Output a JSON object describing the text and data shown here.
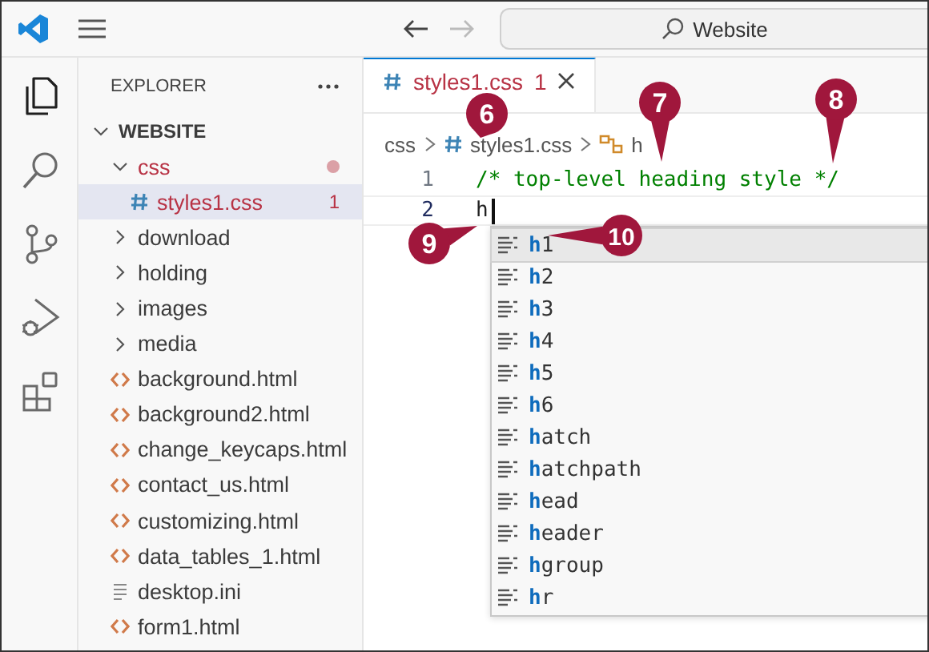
{
  "title_bar": {
    "back_enabled": true,
    "forward_enabled": false,
    "search": "Website"
  },
  "activity_bar": [
    {
      "kind": "explorer",
      "selected": true
    },
    {
      "kind": "search",
      "selected": false
    },
    {
      "kind": "source-control",
      "selected": false
    },
    {
      "kind": "run-debug",
      "selected": false
    },
    {
      "kind": "extensions",
      "selected": false
    }
  ],
  "explorer": {
    "title": "EXPLORER",
    "root": {
      "label": "WEBSITE",
      "expanded": true,
      "children": [
        {
          "label": "css",
          "kind": "folder",
          "expanded": true,
          "has_errors": true,
          "children": [
            {
              "label": "styles1.css",
              "kind": "css",
              "selected": true,
              "has_errors": true,
              "problems": "1"
            }
          ]
        },
        {
          "label": "download",
          "kind": "folder",
          "expanded": false
        },
        {
          "label": "holding",
          "kind": "folder",
          "expanded": false
        },
        {
          "label": "images",
          "kind": "folder",
          "expanded": false
        },
        {
          "label": "media",
          "kind": "folder",
          "expanded": false
        },
        {
          "label": "background.html",
          "kind": "html"
        },
        {
          "label": "background2.html",
          "kind": "html"
        },
        {
          "label": "change_keycaps.html",
          "kind": "html"
        },
        {
          "label": "contact_us.html",
          "kind": "html"
        },
        {
          "label": "customizing.html",
          "kind": "html"
        },
        {
          "label": "data_tables_1.html",
          "kind": "html"
        },
        {
          "label": "desktop.ini",
          "kind": "text"
        },
        {
          "label": "form1.html",
          "kind": "html"
        }
      ]
    }
  },
  "editor": {
    "tabs": [
      {
        "label": "styles1.css",
        "problems": "1",
        "selected": true
      }
    ],
    "breadcrumb": [
      {
        "kind": "folder",
        "label": "css"
      },
      {
        "kind": "css",
        "label": "styles1.css"
      },
      {
        "kind": "symbol",
        "label": "h"
      }
    ],
    "lines": [
      {
        "number": "1",
        "text": "/* top-level heading style */",
        "kind": "comment",
        "current": false
      },
      {
        "number": "2",
        "text": "h",
        "kind": "code",
        "current": true
      }
    ],
    "suggestions": [
      {
        "match": "h",
        "rest": "1",
        "selected": true
      },
      {
        "match": "h",
        "rest": "2",
        "selected": false
      },
      {
        "match": "h",
        "rest": "3",
        "selected": false
      },
      {
        "match": "h",
        "rest": "4",
        "selected": false
      },
      {
        "match": "h",
        "rest": "5",
        "selected": false
      },
      {
        "match": "h",
        "rest": "6",
        "selected": false
      },
      {
        "match": "h",
        "rest": "atch",
        "selected": false
      },
      {
        "match": "h",
        "rest": "atchpath",
        "selected": false
      },
      {
        "match": "h",
        "rest": "ead",
        "selected": false
      },
      {
        "match": "h",
        "rest": "eader",
        "selected": false
      },
      {
        "match": "h",
        "rest": "group",
        "selected": false
      },
      {
        "match": "h",
        "rest": "r",
        "selected": false
      }
    ]
  },
  "callouts": [
    {
      "number": "6"
    },
    {
      "number": "7"
    },
    {
      "number": "8"
    },
    {
      "number": "9"
    },
    {
      "number": "10"
    }
  ]
}
